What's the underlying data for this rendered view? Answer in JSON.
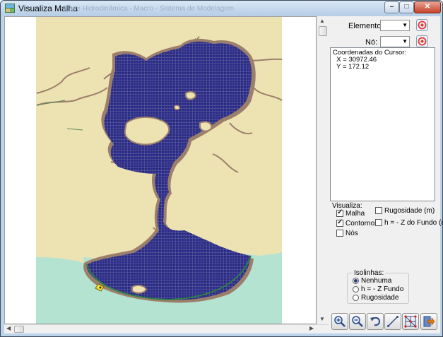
{
  "window": {
    "title": "Visualiza Malha",
    "ghost_title": "Base Hidrodinâmica - Macro - Sistema de Modelagem",
    "buttons": {
      "minimize": "–",
      "maximize": "□",
      "close": "✕"
    }
  },
  "controls": {
    "elemento_label": "Elemento:",
    "no_label": "Nó:",
    "elemento_value": "",
    "no_value": ""
  },
  "cursor": {
    "header": "Coordenadas do Cursor:",
    "x_line": "  X = 30972.46",
    "y_line": "  Y = 172.12"
  },
  "visualiza": {
    "title": "Visualiza:",
    "malha": {
      "label": "Malha",
      "checked": true
    },
    "contornos": {
      "label": "Contornos",
      "checked": true
    },
    "nos": {
      "label": "Nós",
      "checked": false
    },
    "rugosidade": {
      "label": "Rugosidade (m)",
      "checked": false
    },
    "h_fundo": {
      "label": "h = - Z do Fundo (m)",
      "checked": false
    }
  },
  "isolinhas": {
    "title": "Isolinhas:",
    "options": [
      "Nenhuma",
      "h = - Z Fundo",
      "Rugosidade"
    ],
    "selected": "Nenhuma"
  },
  "toolbar": [
    "zoom-in-icon",
    "zoom-out-icon",
    "undo-icon",
    "measure-line-icon",
    "mesh-nodes-icon",
    "exit-icon"
  ],
  "colors": {
    "land": "#ede2b2",
    "sea": "#b4e3d2",
    "mesh": "#1e1e7a",
    "shore": "#9c7f6b"
  }
}
